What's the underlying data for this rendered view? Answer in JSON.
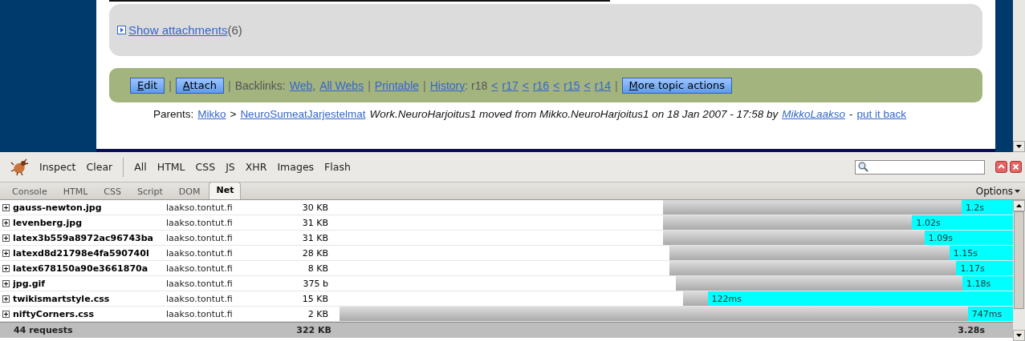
{
  "page": {
    "attachments": {
      "link": "Show attachments",
      "count": "(6)"
    },
    "actions": [
      {
        "kind": "button",
        "text": "Edit"
      },
      {
        "kind": "sep",
        "text": "|"
      },
      {
        "kind": "button",
        "text": "Attach"
      },
      {
        "kind": "sep",
        "text": "|"
      },
      {
        "kind": "label",
        "text": "Backlinks:"
      },
      {
        "kind": "link",
        "text": "Web"
      },
      {
        "kind": "label",
        "text": ","
      },
      {
        "kind": "link",
        "text": "All Webs"
      },
      {
        "kind": "sep",
        "text": "|"
      },
      {
        "kind": "link",
        "text": "Printable"
      },
      {
        "kind": "sep",
        "text": "|"
      },
      {
        "kind": "link",
        "text": "History"
      },
      {
        "kind": "label",
        "text": ": r18"
      },
      {
        "kind": "link",
        "text": "<"
      },
      {
        "kind": "link",
        "text": "r17"
      },
      {
        "kind": "link",
        "text": "<"
      },
      {
        "kind": "link",
        "text": "r16"
      },
      {
        "kind": "link",
        "text": "<"
      },
      {
        "kind": "link",
        "text": "r15"
      },
      {
        "kind": "link",
        "text": "<"
      },
      {
        "kind": "link",
        "text": "r14"
      },
      {
        "kind": "sep",
        "text": "|"
      },
      {
        "kind": "button",
        "text": "More topic actions"
      }
    ],
    "parents": [
      {
        "kind": "text",
        "text": "Parents:"
      },
      {
        "kind": "link",
        "text": "Mikko"
      },
      {
        "kind": "text",
        "text": ">"
      },
      {
        "kind": "link",
        "text": "NeuroSumeatJarjestelmat"
      },
      {
        "kind": "italic",
        "text": "Work.NeuroHarjoitus1 moved from Mikko.NeuroHarjoitus1 on 18 Jan 2007 - 17:58 by"
      },
      {
        "kind": "italic-link",
        "text": "MikkoLaakso"
      },
      {
        "kind": "text",
        "text": "-"
      },
      {
        "kind": "link",
        "text": "put it back"
      }
    ]
  },
  "firebug": {
    "toolbar": [
      {
        "kind": "button",
        "text": "Inspect"
      },
      {
        "kind": "button",
        "text": "Clear"
      },
      {
        "kind": "sep"
      },
      {
        "kind": "button",
        "text": "All"
      },
      {
        "kind": "button",
        "text": "HTML"
      },
      {
        "kind": "button",
        "text": "CSS"
      },
      {
        "kind": "button",
        "text": "JS"
      },
      {
        "kind": "button",
        "text": "XHR"
      },
      {
        "kind": "button",
        "text": "Images"
      },
      {
        "kind": "button",
        "text": "Flash"
      }
    ],
    "tabs": [
      {
        "label": "Console",
        "selected": false
      },
      {
        "label": "HTML",
        "selected": false
      },
      {
        "label": "CSS",
        "selected": false
      },
      {
        "label": "Script",
        "selected": false
      },
      {
        "label": "DOM",
        "selected": false
      },
      {
        "label": "Net",
        "selected": true
      }
    ],
    "options": "Options",
    "rows": [
      {
        "file": "gauss-newton.jpg",
        "domain": "laakso.tontut.fi",
        "size": "30 KB",
        "time": "1.2s",
        "waiting": {
          "level": 0.853
        }
      },
      {
        "file": "levenberg.jpg",
        "domain": "laakso.tontut.fi",
        "size": "31 KB",
        "time": "1.02s",
        "waiting": {
          "level": 0.712
        }
      },
      {
        "file": "latex3b559a8972ac96743ba",
        "domain": "laakso.tontut.fi",
        "size": "31 KB",
        "time": "1.09s",
        "waiting": {
          "level": 0.747
        }
      },
      {
        "file": "latexd8d21798e4fa590740l",
        "domain": "laakso.tontut.fi",
        "size": "28 KB",
        "time": "1.15s",
        "waiting": {
          "level": 0.815
        }
      },
      {
        "file": "latex678150a90e3661870a",
        "domain": "laakso.tontut.fi",
        "size": "8 KB",
        "time": "1.17s",
        "waiting": {
          "level": 0.835
        }
      },
      {
        "file": "jpg.gif",
        "domain": "laakso.tontut.fi",
        "size": "375 b",
        "time": "1.18s",
        "waiting": {
          "level": 0.85
        }
      },
      {
        "file": "twikismartstyle.css",
        "domain": "laakso.tontut.fi",
        "size": "15 KB",
        "time": "122ms",
        "waiting": {
          "level": 0.074
        }
      },
      {
        "file": "niftyCorners.css",
        "domain": "laakso.tontut.fi",
        "size": "2 KB",
        "time": "747ms",
        "waiting": {
          "level": 0.933
        }
      }
    ],
    "summary": {
      "requests": "44 requests",
      "size": "322 KB",
      "time": "3.28s"
    }
  }
}
